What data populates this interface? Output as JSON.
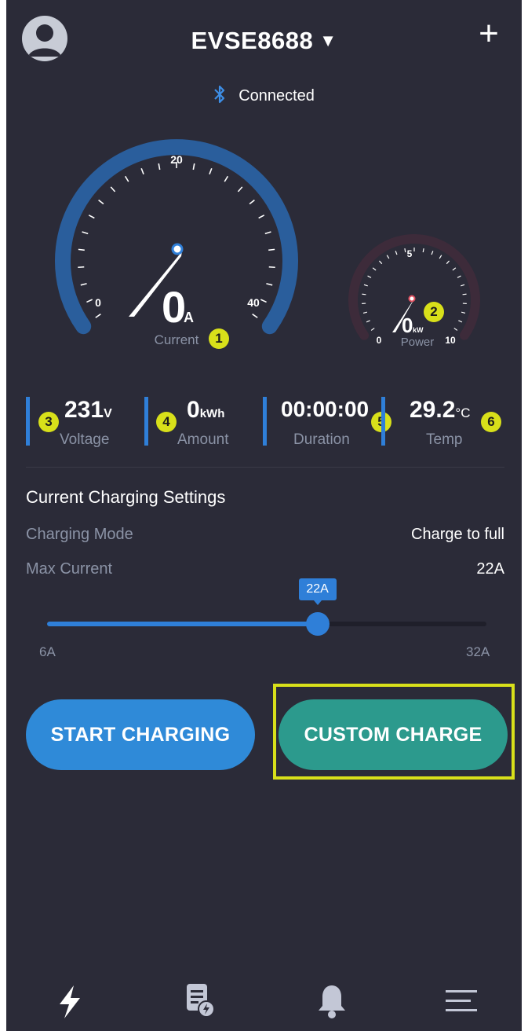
{
  "header": {
    "title": "EVSE8688",
    "dropdown_glyph": "▼",
    "add_glyph": "+",
    "avatar_icon": "user-avatar-icon",
    "add_icon": "plus-icon"
  },
  "connection": {
    "icon": "bluetooth-icon",
    "glyph": "✱",
    "text": "Connected"
  },
  "gauges": {
    "current": {
      "value": "0",
      "unit": "A",
      "label": "Current",
      "min": "0",
      "mid": "20",
      "max": "40",
      "badge": "1",
      "fill_fraction": 0
    },
    "power": {
      "value": "0",
      "unit": "kW",
      "label": "Power",
      "min": "0",
      "mid": "5",
      "max": "10",
      "badge": "2",
      "fill_fraction": 0
    }
  },
  "stats": [
    {
      "value": "231",
      "unit": "V",
      "label": "Voltage",
      "badge": "3"
    },
    {
      "value": "0",
      "unit": "kWh",
      "label": "Amount",
      "badge": "4"
    },
    {
      "value": "00:00:00",
      "unit": "",
      "label": "Duration",
      "badge": "5"
    },
    {
      "value": "29.2",
      "unit": "°C",
      "label": "Temp",
      "badge": "6"
    }
  ],
  "settings": {
    "title": "Current Charging Settings",
    "mode_label": "Charging Mode",
    "mode_value": "Charge to full",
    "max_label": "Max Current",
    "max_value": "22A"
  },
  "slider": {
    "tooltip": "22A",
    "min_label": "6A",
    "max_label": "32A",
    "min": 6,
    "max": 32,
    "value": 22
  },
  "buttons": {
    "start": "START CHARGING",
    "custom": "CUSTOM CHARGE"
  },
  "tabs": [
    {
      "icon": "lightning-bolt-icon",
      "active": true
    },
    {
      "icon": "charge-records-icon",
      "active": false
    },
    {
      "icon": "notification-bell-icon",
      "active": false
    },
    {
      "icon": "menu-icon",
      "active": false
    }
  ],
  "colors": {
    "background": "#2b2b38",
    "accent_blue": "#2f8ad8",
    "accent_teal": "#2c9a8d",
    "highlight_yellow": "#d8e01a",
    "muted_text": "#8b93a6"
  }
}
